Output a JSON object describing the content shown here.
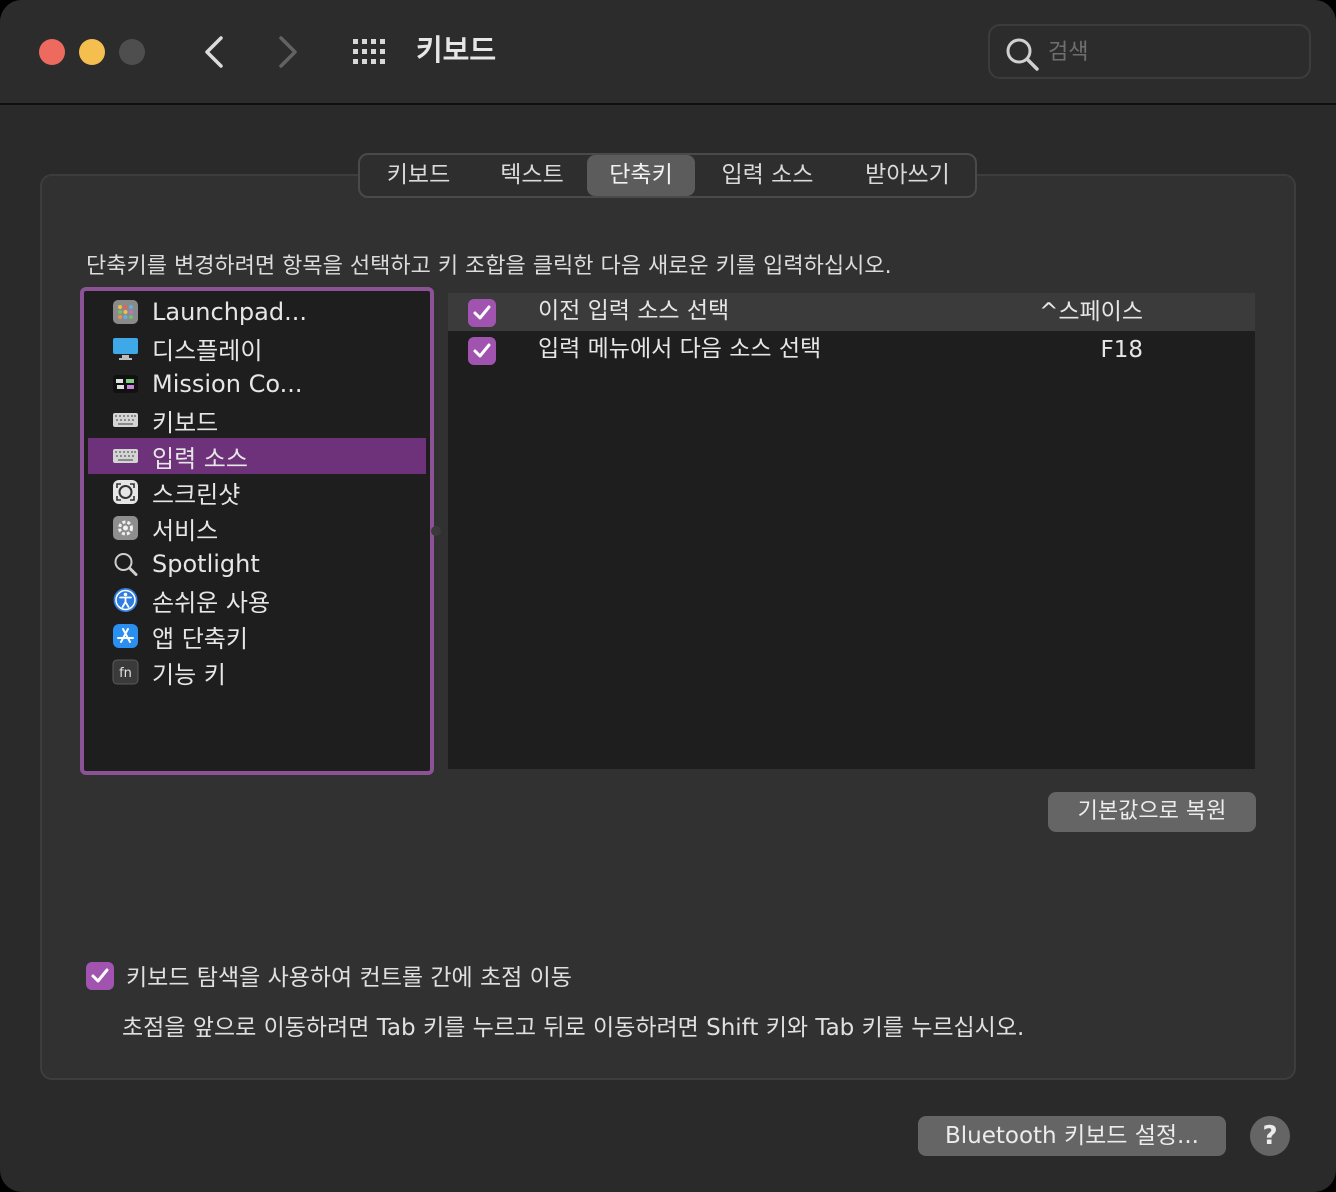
{
  "window": {
    "title": "키보드"
  },
  "search": {
    "placeholder": "검색",
    "value": ""
  },
  "tabs": [
    {
      "label": "키보드",
      "active": false
    },
    {
      "label": "텍스트",
      "active": false
    },
    {
      "label": "단축키",
      "active": true
    },
    {
      "label": "입력 소스",
      "active": false
    },
    {
      "label": "받아쓰기",
      "active": false
    }
  ],
  "main": {
    "instructions": "단축키를 변경하려면 항목을 선택하고 키 조합을 클릭한 다음 새로운 키를 입력하십시오."
  },
  "categories": [
    {
      "label": "Launchpad...",
      "icon": "launchpad-icon",
      "selected": false
    },
    {
      "label": "디스플레이",
      "icon": "display-icon",
      "selected": false
    },
    {
      "label": "Mission Co...",
      "icon": "mission-control-icon",
      "selected": false
    },
    {
      "label": "키보드",
      "icon": "keyboard-icon",
      "selected": false
    },
    {
      "label": "입력 소스",
      "icon": "keyboard-icon",
      "selected": true
    },
    {
      "label": "스크린샷",
      "icon": "screenshot-icon",
      "selected": false
    },
    {
      "label": "서비스",
      "icon": "gear-icon",
      "selected": false
    },
    {
      "label": "Spotlight",
      "icon": "magnifier-icon",
      "selected": false
    },
    {
      "label": "손쉬운 사용",
      "icon": "accessibility-icon",
      "selected": false
    },
    {
      "label": "앱 단축키",
      "icon": "app-store-icon",
      "selected": false
    },
    {
      "label": "기능 키",
      "icon": "fn-key-icon",
      "selected": false
    }
  ],
  "shortcuts": [
    {
      "label": "이전 입력 소스 선택",
      "key": "^스페이스",
      "checked": true,
      "highlighted": true
    },
    {
      "label": "입력 메뉴에서 다음 소스 선택",
      "key": "F18",
      "checked": true,
      "highlighted": false
    }
  ],
  "buttons": {
    "restore_defaults": "기본값으로 복원",
    "bluetooth": "Bluetooth 키보드 설정...",
    "help": "?"
  },
  "keyboard_navigation": {
    "label": "키보드 탐색을 사용하여 컨트롤 간에 초점 이동",
    "checked": true,
    "hint": "초점을 앞으로 이동하려면 Tab 키를 누르고 뒤로 이동하려면 Shift 키와 Tab 키를 누르십시오."
  },
  "colors": {
    "accent": "#a153b0",
    "selection": "#6d3279",
    "focus_ring": "#8c5296",
    "close": "#ed6a5e",
    "minimize": "#f5bf4f",
    "zoom_inactive": "#4e4e4e"
  }
}
